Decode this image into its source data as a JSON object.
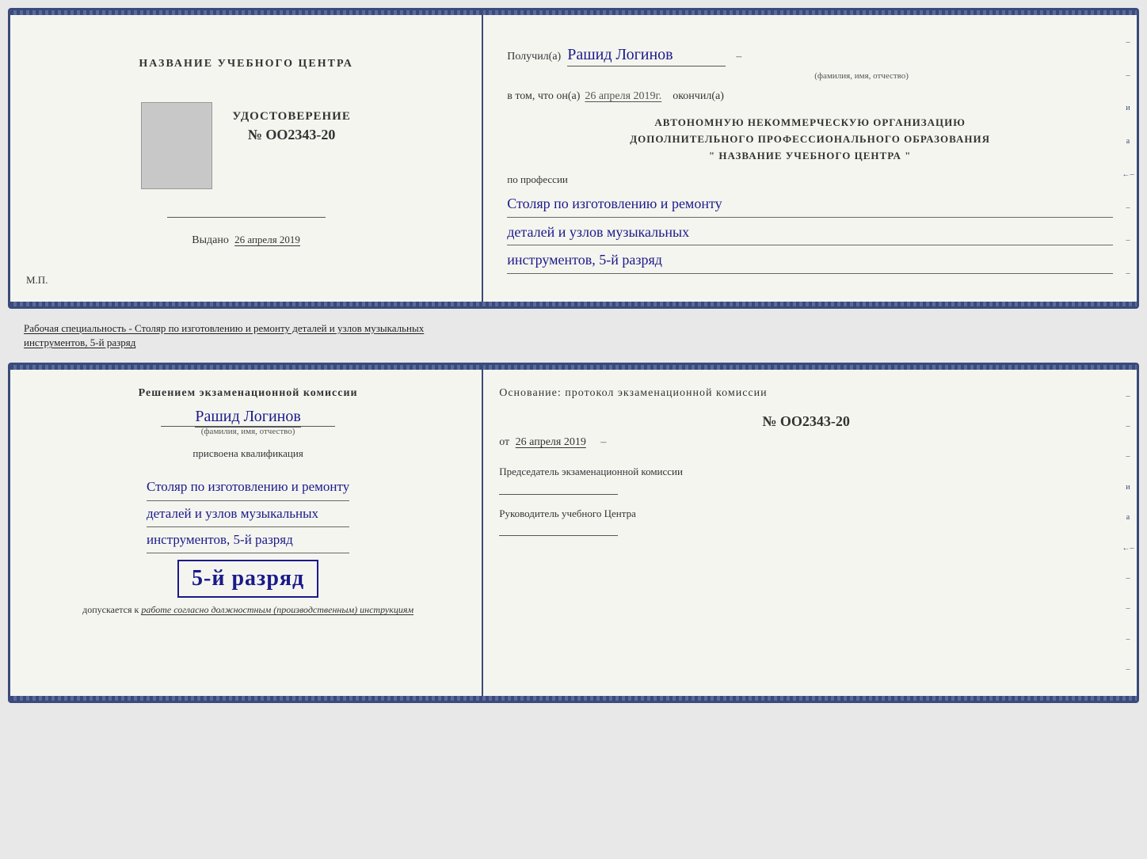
{
  "colors": {
    "accent": "#3a4a7a",
    "handwriting": "#1a1a8a",
    "text": "#333",
    "muted": "#555"
  },
  "top_doc": {
    "left": {
      "org_name": "НАЗВАНИЕ УЧЕБНОГО ЦЕНТРА",
      "cert_title": "УДОСТОВЕРЕНИЕ",
      "cert_number": "№ OO2343-20",
      "issued_label": "Выдано",
      "issued_date": "26 апреля 2019",
      "mp_label": "М.П."
    },
    "right": {
      "received_label": "Получил(а)",
      "recipient_name": "Рашид Логинов",
      "name_subtitle": "(фамилия, имя, отчество)",
      "date_label": "в том, что он(а)",
      "date_value": "26 апреля 2019г.",
      "finished_label": "окончил(а)",
      "org_line1": "АВТОНОМНУЮ НЕКОММЕРЧЕСКУЮ ОРГАНИЗАЦИЮ",
      "org_line2": "ДОПОЛНИТЕЛЬНОГО ПРОФЕССИОНАЛЬНОГО ОБРАЗОВАНИЯ",
      "org_line3": "\"  НАЗВАНИЕ УЧЕБНОГО ЦЕНТРА  \"",
      "profession_label": "по профессии",
      "profession_line1": "Столяр по изготовлению и ремонту",
      "profession_line2": "деталей и узлов музыкальных",
      "profession_line3": "инструментов, 5-й разряд"
    }
  },
  "middle_label": {
    "prefix": "Рабочая специальность - Столяр по изготовлению и ремонту деталей и узлов музыкальных",
    "suffix": "инструментов, 5-й разряд"
  },
  "bottom_doc": {
    "left": {
      "decision_line1": "Решением  экзаменационной  комиссии",
      "person_name": "Рашид Логинов",
      "name_subtitle": "(фамилия, имя, отчество)",
      "qual_label": "присвоена квалификация",
      "qual_line1": "Столяр по изготовлению и ремонту",
      "qual_line2": "деталей и узлов музыкальных",
      "qual_line3": "инструментов, 5-й разряд",
      "rank_label": "5-й разряд",
      "допуск_label": "допускается к",
      "допуск_value": "работе согласно должностным (производственным) инструкциям"
    },
    "right": {
      "basis_label": "Основание:  протокол  экзаменационной  комиссии",
      "protocol_number": "№  OO2343-20",
      "from_label": "от",
      "from_date": "26 апреля 2019",
      "chairman_label": "Председатель экзаменационной комиссии",
      "head_label": "Руководитель учебного Центра"
    }
  }
}
